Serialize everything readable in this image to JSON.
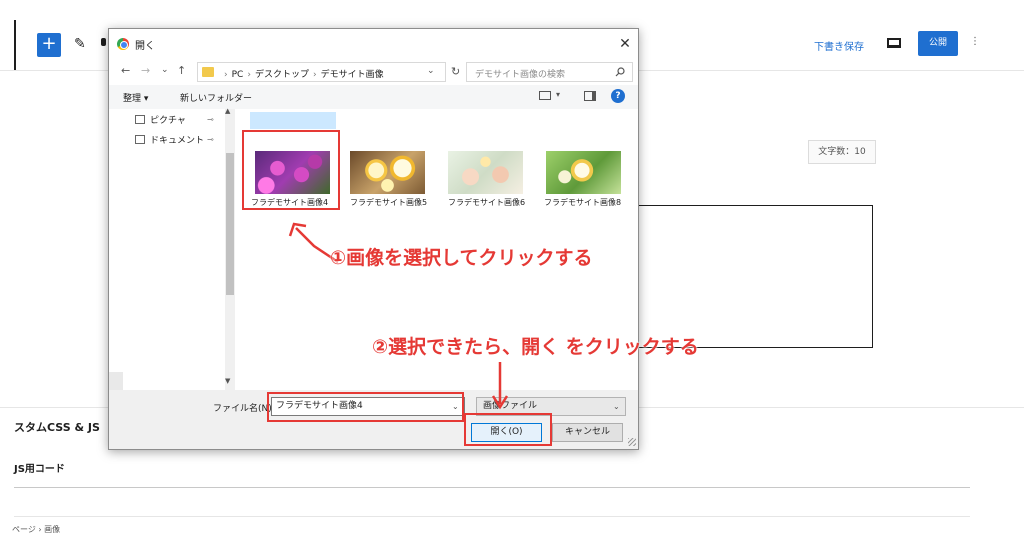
{
  "editor": {
    "draft_label": "下書き保存",
    "publish_label": "公開",
    "more_label": "⋮",
    "char_count": "文字数：10",
    "custom_css_js": "スタムCSS & JS",
    "js_code": "JS用コード",
    "breadcrumb": "ページ › 画像"
  },
  "dialog": {
    "title": "開く",
    "nav": {
      "back": "←",
      "forward": "→",
      "recent": "⌄",
      "up": "↑"
    },
    "address": {
      "parts": [
        "PC",
        "デスクトップ",
        "デモサイト画像"
      ],
      "sep": "›"
    },
    "search_placeholder": "デモサイト画像の検索",
    "command_bar": {
      "organize": "整理 ▾",
      "new_folder": "新しいフォルダー",
      "help": "?"
    },
    "sidebar": [
      {
        "label": "ピクチャ",
        "pin": "📌"
      },
      {
        "label": "ドキュメント",
        "pin": "📌"
      }
    ],
    "files": [
      {
        "name": "フラデモサイト画像4",
        "selected": true
      },
      {
        "name": "フラデモサイト画像5",
        "selected": false
      },
      {
        "name": "フラデモサイト画像6",
        "selected": false
      },
      {
        "name": "フラデモサイト画像8",
        "selected": false
      }
    ],
    "file_name_label": "ファイル名(N):",
    "file_name_value": "フラデモサイト画像4",
    "file_type": "画像ファイル",
    "open_button": "開く(O)",
    "cancel_button": "キャンセル"
  },
  "annotations": {
    "step1": "①画像を選択してクリックする",
    "step2": "②選択できたら、開く をクリックする",
    "color": "#e53935"
  }
}
